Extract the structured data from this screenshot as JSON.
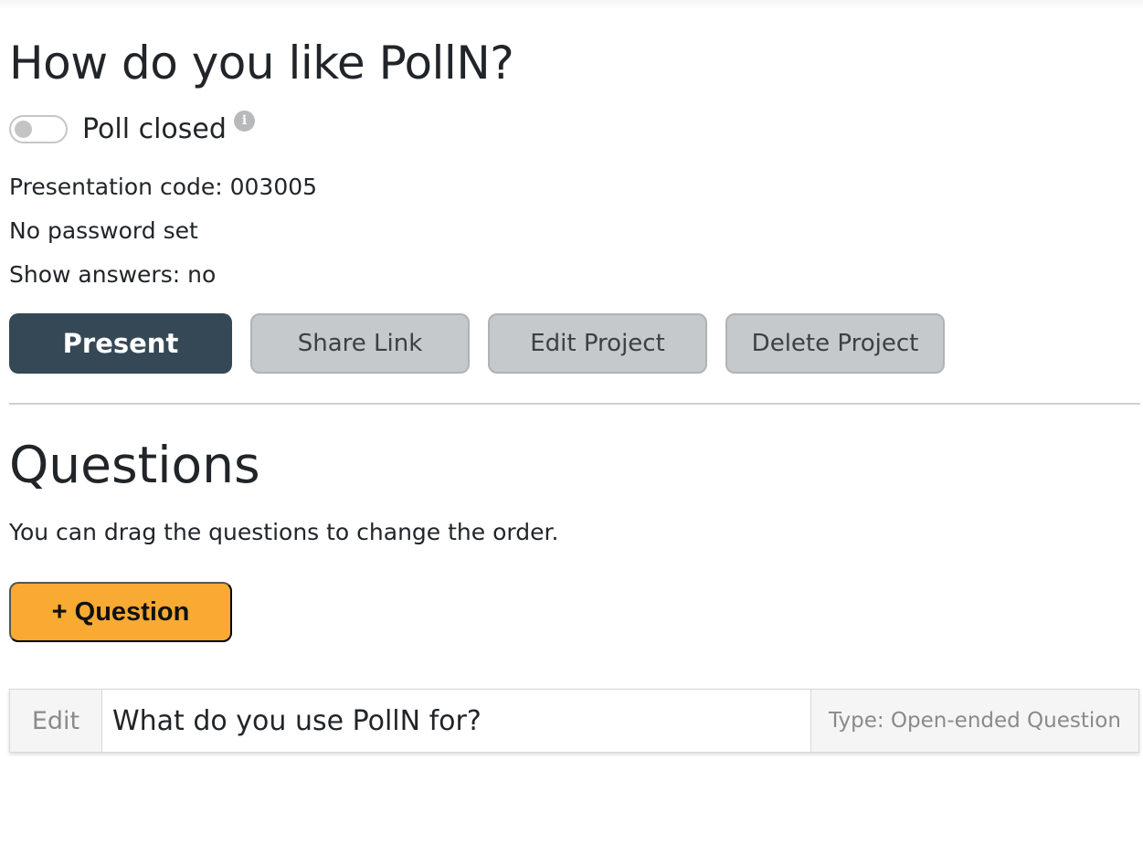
{
  "project": {
    "title": "How do you like PollN?",
    "poll_status_label": "Poll closed",
    "poll_open": false,
    "info_icon_glyph": "i",
    "presentation_code": "Presentation code: 003005",
    "password_status": "No password set",
    "show_answers": "Show answers: no"
  },
  "actions": {
    "present": "Present",
    "share_link": "Share Link",
    "edit_project": "Edit Project",
    "delete_project": "Delete Project"
  },
  "questions": {
    "heading": "Questions",
    "hint": "You can drag the questions to change the order.",
    "add_button": "+ Question",
    "items": [
      {
        "edit_label": "Edit",
        "text": "What do you use PollN for?",
        "type": "Type: Open-ended Question"
      }
    ]
  },
  "colors": {
    "present_bg": "#344856",
    "add_question_bg": "#f9aa33",
    "secondary_button_bg": "#c6c9cc"
  },
  "icons": {
    "info": "info-icon",
    "toggle": "toggle-switch"
  }
}
